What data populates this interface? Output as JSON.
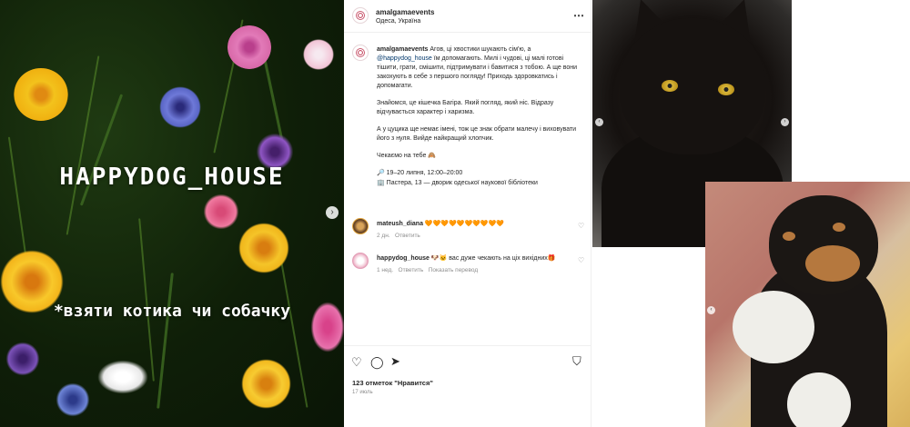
{
  "poster": {
    "title": "HAPPYDOG_HOUSE",
    "subtitle": "*взяти котика чи собачку",
    "next_arrow": "›"
  },
  "post": {
    "header": {
      "username": "amalgamaevents",
      "location": "Одеса, Україна",
      "more_icon": "⋯"
    },
    "caption": {
      "username": "amalgamaevents",
      "p1_before": "Агов, ці хвостики шукають сім'ю, а ",
      "mention": "@happydog_house",
      "p1_after": " їм допомагають. Милі і чудові, ці малі готові тішити, грати, смішити, підтримувати і бавитися з тобою. А ще вони закохують в себе з першого погляду! Приходь здоровкатись і допомагати.",
      "p2": "Знайомся, це кішечка Багіра. Який погляд, який ніс. Відразу відчувається характер і харизма.",
      "p3": "А у цуцика ще немає імені, тож це знак обрати малечу і виховувати його з нуля. Вийде найкращий хлопчик.",
      "p4": "Чекаємо на тебе 🙈",
      "p5": "🔎 19–20 липня, 12:00–20:00",
      "p6": "🏢 Пастера, 13 — дворик одеської наукової бібліотеки"
    },
    "comments": [
      {
        "username": "mateush_diana",
        "text": "🧡🧡🧡🧡🧡🧡🧡🧡🧡🧡",
        "time": "2 дн.",
        "reply": "Ответить"
      },
      {
        "username": "happydog_house",
        "text": "🐶🐱 вас дуже чекають на ціх вихідних🎁",
        "time": "1 нед.",
        "reply": "Ответить",
        "translate": "Показать перевод"
      }
    ],
    "likes": "123 отметок \"Нравится\"",
    "date": "17 июль"
  },
  "colors": {
    "mention": "#00376b",
    "meta": "#8e8e8e",
    "text": "#262626"
  }
}
